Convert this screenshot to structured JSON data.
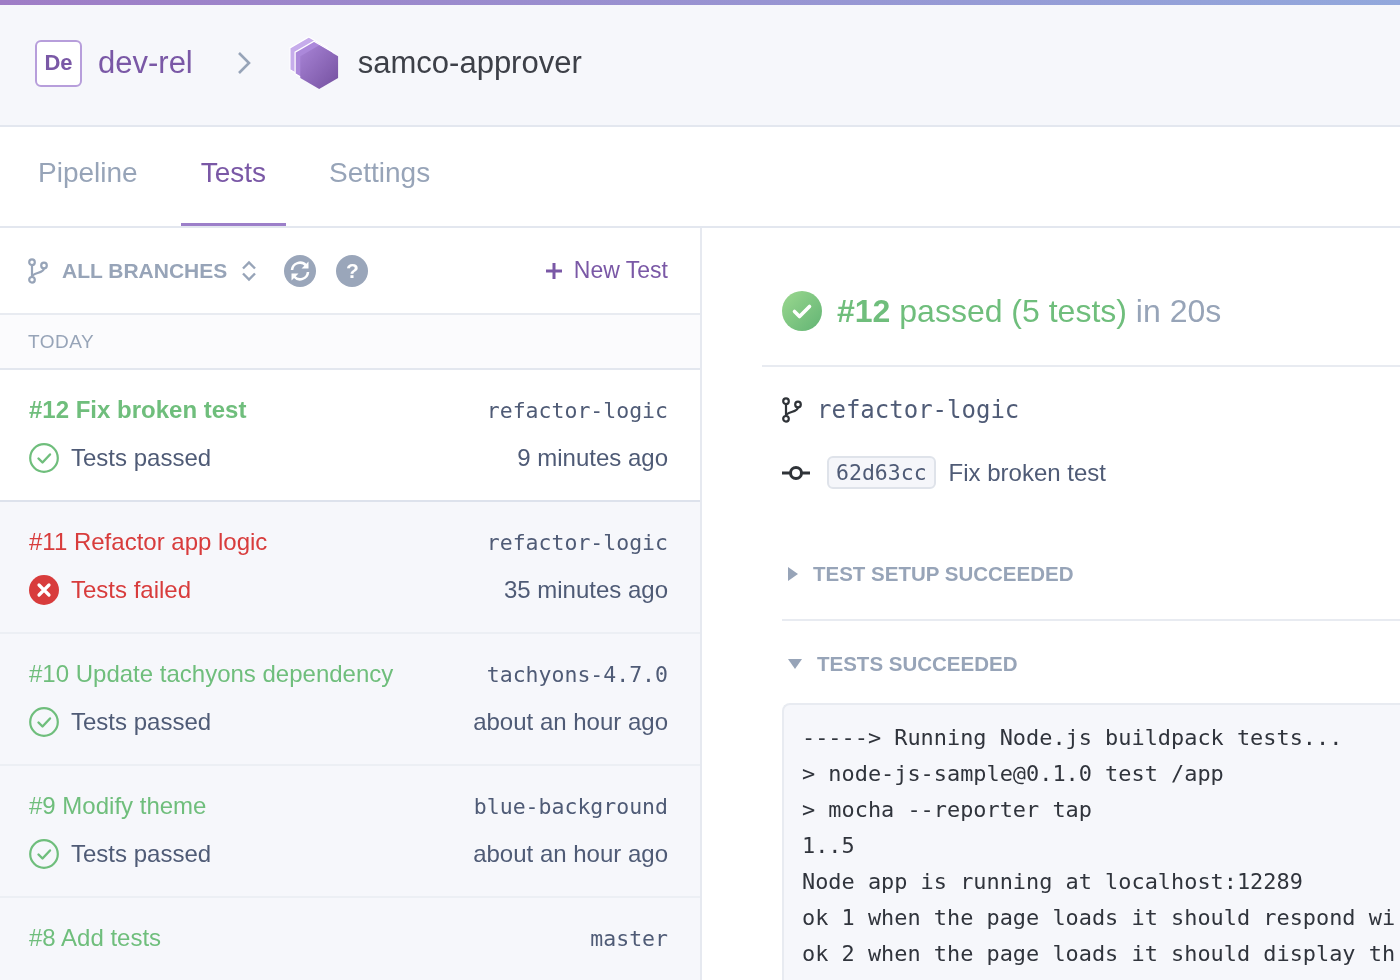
{
  "header": {
    "team_badge": "De",
    "team": "dev-rel",
    "app": "samco-approver"
  },
  "tabs": [
    {
      "label": "Pipeline",
      "selected": false
    },
    {
      "label": "Tests",
      "selected": true
    },
    {
      "label": "Settings",
      "selected": false
    }
  ],
  "toolbar": {
    "branch_filter": "ALL BRANCHES",
    "help": "?",
    "new_test": "New Test"
  },
  "run_groups": [
    {
      "heading": "TODAY",
      "runs": [
        {
          "title": "#12 Fix broken test",
          "branch": "refactor-logic",
          "kind": "passed",
          "status_text": "Tests passed",
          "time": "9 minutes ago",
          "selected": true
        },
        {
          "title": "#11 Refactor app logic",
          "branch": "refactor-logic",
          "kind": "failed",
          "status_text": "Tests failed",
          "time": "35 minutes ago",
          "selected": false
        },
        {
          "title": "#10 Update tachyons dependency",
          "branch": "tachyons-4.7.0",
          "kind": "passed",
          "status_text": "Tests passed",
          "time": "about an hour ago",
          "selected": false
        },
        {
          "title": "#9 Modify theme",
          "branch": "blue-background",
          "kind": "passed",
          "status_text": "Tests passed",
          "time": "about an hour ago",
          "selected": false
        },
        {
          "title": "#8 Add tests",
          "branch": "master",
          "kind": "passed",
          "selected": false
        }
      ]
    }
  ],
  "detail": {
    "summary": {
      "kind": "passed",
      "number": "#12",
      "result": "passed (5 tests)",
      "duration": "in 20s"
    },
    "branch": "refactor-logic",
    "commit": {
      "hash": "62d63cc",
      "message": "Fix broken test"
    },
    "sections": [
      {
        "title": "TEST SETUP SUCCEEDED",
        "expanded": false
      },
      {
        "title": "TESTS SUCCEEDED",
        "expanded": true,
        "log": [
          "-----> Running Node.js buildpack tests...",
          "> node-js-sample@0.1.0 test /app",
          "> mocha --reporter tap",
          "1..5",
          "Node app is running at localhost:12289",
          "ok 1 when the page loads it should respond wi",
          "ok 2 when the page loads it should display th"
        ]
      }
    ]
  }
}
